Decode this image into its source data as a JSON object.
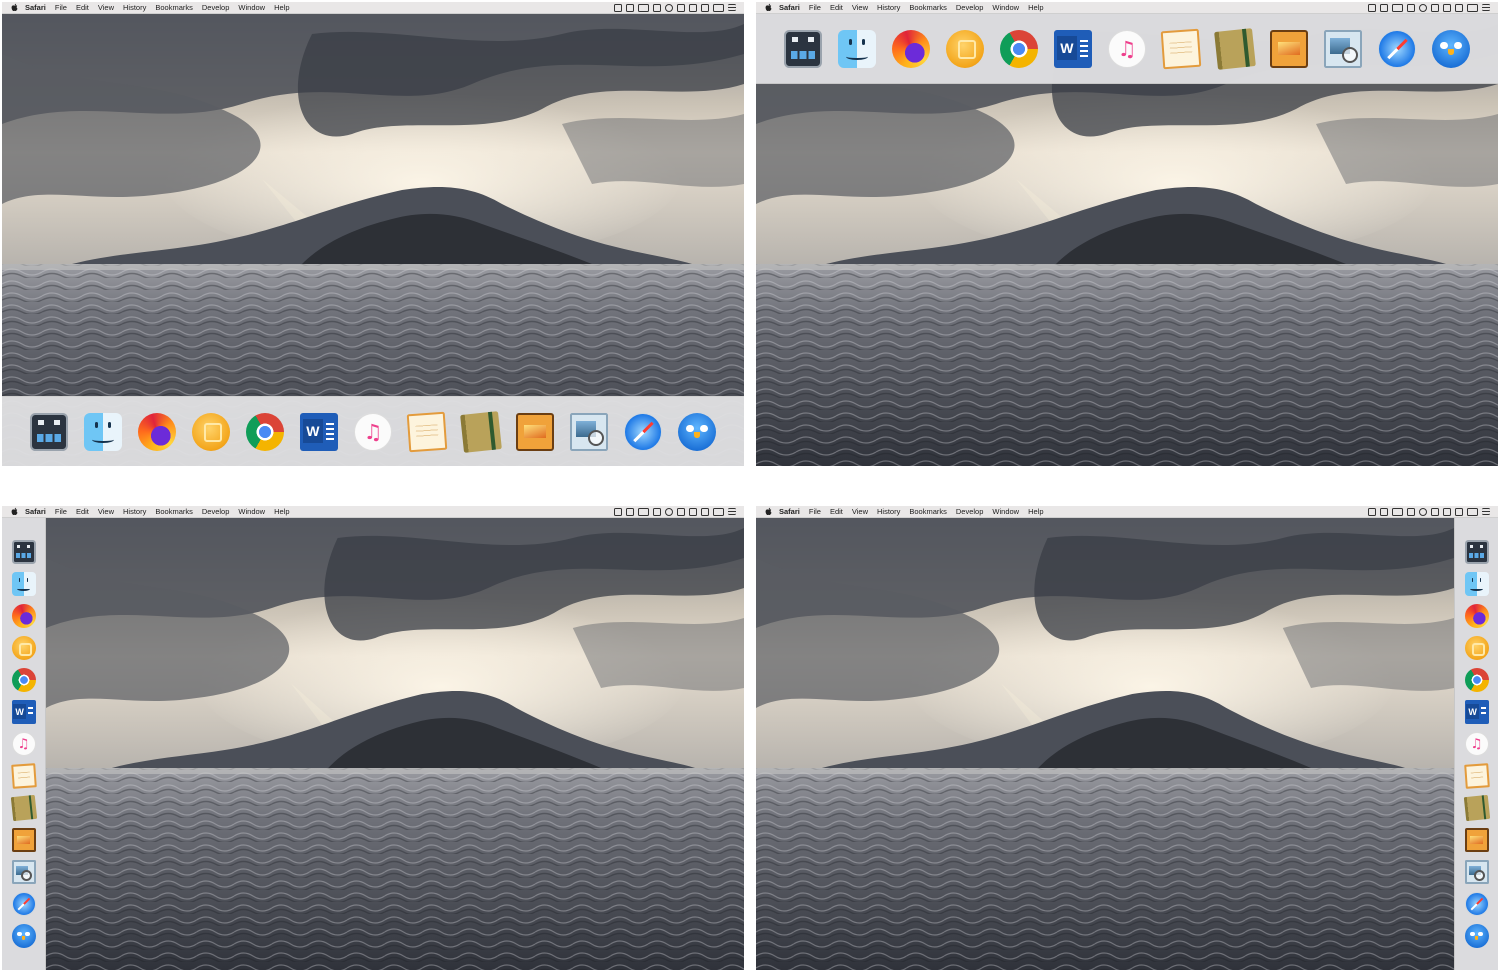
{
  "menubar": {
    "app_name": "Safari",
    "items": [
      "File",
      "Edit",
      "View",
      "History",
      "Bookmarks",
      "Develop",
      "Window",
      "Help"
    ]
  },
  "dock_positions": [
    "bottom",
    "top",
    "left",
    "right"
  ],
  "dock_apps": [
    {
      "name": "robot-app",
      "icon": "robot-icon"
    },
    {
      "name": "finder",
      "icon": "finder-icon"
    },
    {
      "name": "firefox",
      "icon": "firefox-icon"
    },
    {
      "name": "honey-app",
      "icon": "hive-icon"
    },
    {
      "name": "chrome",
      "icon": "chrome-icon"
    },
    {
      "name": "word",
      "icon": "word-icon"
    },
    {
      "name": "music",
      "icon": "music-icon"
    },
    {
      "name": "notepad",
      "icon": "notepad-icon"
    },
    {
      "name": "notebook",
      "icon": "notebook-icon"
    },
    {
      "name": "pixel-editor",
      "icon": "pixel-icon"
    },
    {
      "name": "preview",
      "icon": "preview-icon"
    },
    {
      "name": "safari",
      "icon": "safari-icon"
    },
    {
      "name": "tweetbot",
      "icon": "tweetbot-icon"
    }
  ],
  "colors": {
    "menubar_bg": "#e9e7e7",
    "dock_bg": "#e0e0e2",
    "sky_light": "#d9d2c6",
    "cloud_dark": "#3f434c",
    "sea": "#5d6068"
  }
}
